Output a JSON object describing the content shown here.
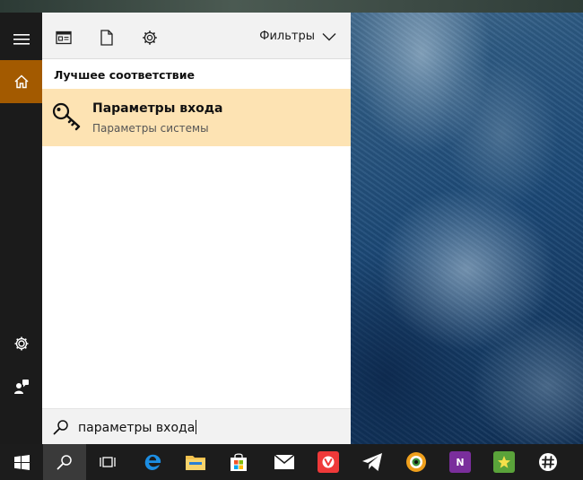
{
  "colors": {
    "accent": "#a35a00",
    "highlight": "#fde3b3",
    "rail": "#1b1b1b",
    "taskbar": "#1c1c1c"
  },
  "rail": {
    "items": [
      {
        "icon": "hamburger-menu-icon"
      },
      {
        "icon": "home-icon",
        "active": true
      },
      {
        "icon": "settings-gear-icon"
      },
      {
        "icon": "user-feedback-icon"
      }
    ]
  },
  "toolbar": {
    "icons": [
      "apps-view-icon",
      "documents-icon",
      "settings-icon"
    ],
    "filters_label": "Фильтры"
  },
  "results": {
    "section_title": "Лучшее соответствие",
    "best_match": {
      "icon": "key-icon",
      "title": "Параметры входа",
      "subtitle": "Параметры системы"
    }
  },
  "search": {
    "query": "параметры входа"
  },
  "taskbar": {
    "buttons": [
      {
        "icon": "windows-start-icon"
      },
      {
        "icon": "search-icon",
        "pressed": true
      },
      {
        "icon": "task-view-icon"
      },
      {
        "icon": "edge-browser-icon"
      },
      {
        "icon": "file-explorer-icon"
      },
      {
        "icon": "store-icon"
      },
      {
        "icon": "mail-icon"
      },
      {
        "icon": "vivaldi-icon"
      },
      {
        "icon": "telegram-icon"
      },
      {
        "icon": "xnview-icon"
      },
      {
        "icon": "onenote-icon",
        "label": "N"
      },
      {
        "icon": "green-app-icon"
      },
      {
        "icon": "slack-icon"
      }
    ]
  }
}
